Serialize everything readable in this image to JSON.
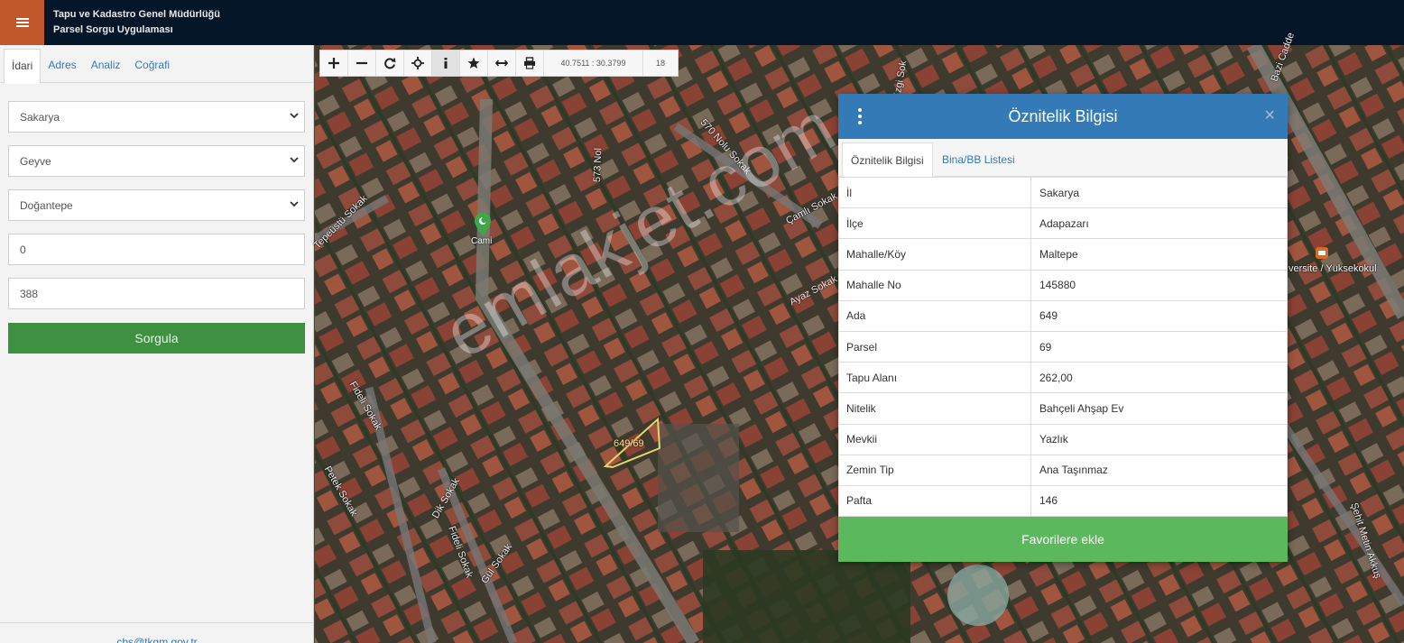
{
  "header": {
    "title_line1": "Tapu ve Kadastro Genel Müdürlüğü",
    "title_line2": "Parsel Sorgu Uygulaması",
    "menu_icon": "hamburger-icon",
    "menu_color": "#c0582b"
  },
  "sidebar": {
    "tabs": [
      {
        "label": "İdari",
        "active": true
      },
      {
        "label": "Adres"
      },
      {
        "label": "Analiz"
      },
      {
        "label": "Coğrafi"
      }
    ],
    "il_select": "Sakarya",
    "ilce_select": "Geyve",
    "mahalle_select": "Doğantepe",
    "ada_input": "0",
    "parsel_input": "388",
    "query_button": "Sorgula",
    "footer_email": "cbs@tkgm.gov.tr"
  },
  "map": {
    "coordinates": "40.7511 : 30.3799",
    "zoom": "18",
    "tools": [
      "plus-icon",
      "minus-icon",
      "refresh-icon",
      "crosshair-icon",
      "info-icon",
      "star-icon",
      "measure-icon",
      "print-icon"
    ],
    "streets": {
      "s573": "573 Nol",
      "s570": "570 Nolu Sokak",
      "camli": "Çamlı Sokak",
      "ayaz": "Ayaz Sokak",
      "tepeustu": "Tepeüstü Sokak",
      "fideli1": "Fideli Sokak",
      "fideli2": "Fideli Sokak",
      "petek": "Petek Sokak",
      "dik": "Dik Sokak",
      "gul": "Gül Sokak",
      "ezgi": "Ezgi Sok",
      "bazi": "Bazi Cadde",
      "sehit": "Şehit Metin Akkuş"
    },
    "poi_cami": "Cami",
    "poi_uni": "versite / Yüksekokul",
    "parcel_label": "649/69",
    "watermark": "emlakjet.com"
  },
  "popup": {
    "title": "Öznitelik Bilgisi",
    "close": "×",
    "tab1": "Öznitelik Bilgisi",
    "tab2": "Bina/BB Listesi",
    "rows": [
      {
        "key": "İl",
        "value": "Sakarya"
      },
      {
        "key": "İlçe",
        "value": "Adapazarı"
      },
      {
        "key": "Mahalle/Köy",
        "value": "Maltepe"
      },
      {
        "key": "Mahalle No",
        "value": "145880"
      },
      {
        "key": "Ada",
        "value": "649"
      },
      {
        "key": "Parsel",
        "value": "69"
      },
      {
        "key": "Tapu Alanı",
        "value": "262,00"
      },
      {
        "key": "Nitelik",
        "value": "Bahçeli Ahşap Ev"
      },
      {
        "key": "Mevkii",
        "value": "Yazlık"
      },
      {
        "key": "Zemin Tip",
        "value": "Ana Taşınmaz"
      },
      {
        "key": "Pafta",
        "value": "146"
      }
    ],
    "favorite_button": "Favorilere ekle",
    "accent_color": "#337ab7",
    "button_color": "#5cb85c"
  }
}
